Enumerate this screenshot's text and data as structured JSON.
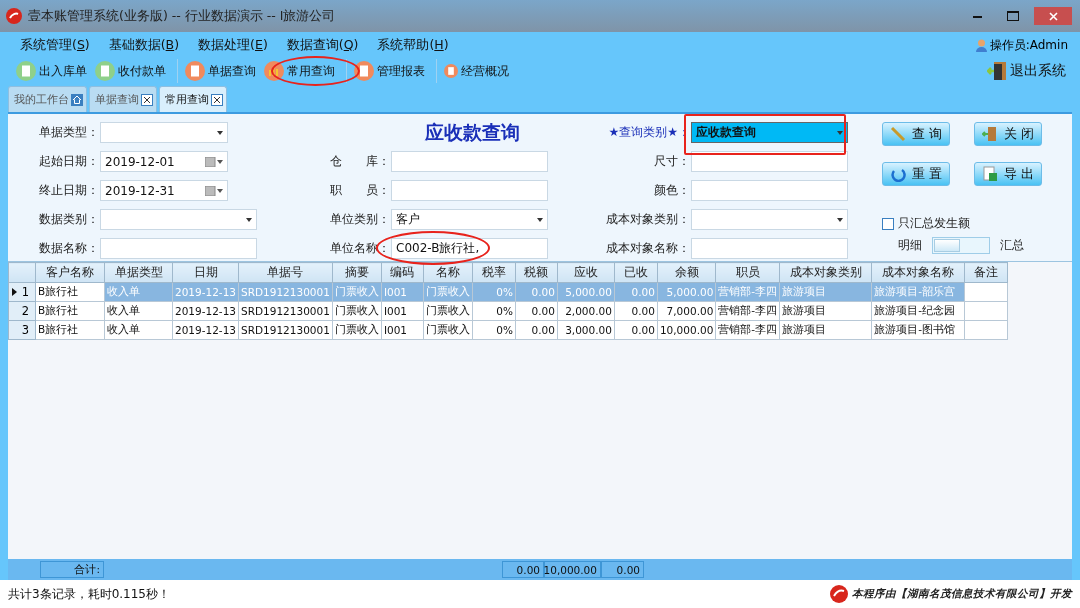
{
  "window": {
    "title": "壹本账管理系统(业务版) -- 行业数据演示 -- I旅游公司"
  },
  "menu": [
    {
      "label": "系统管理(",
      "key": "S",
      "tail": ")"
    },
    {
      "label": "基础数据(",
      "key": "B",
      "tail": ")"
    },
    {
      "label": "数据处理(",
      "key": "E",
      "tail": ")"
    },
    {
      "label": "数据查询(",
      "key": "Q",
      "tail": ")"
    },
    {
      "label": "系统帮助(",
      "key": "H",
      "tail": ")"
    }
  ],
  "operator": "操作员:Admin",
  "toolbar": [
    {
      "label": "出入库单",
      "kind": "stock",
      "separator_before": false
    },
    {
      "label": "收付款单",
      "kind": "payment",
      "separator_before": false
    },
    {
      "label": "单据查询",
      "kind": "document",
      "separator_before": true
    },
    {
      "label": "常用查询",
      "kind": "chart",
      "separator_before": false
    },
    {
      "label": "管理报表",
      "kind": "report",
      "separator_before": true
    },
    {
      "label": "经营概况",
      "kind": "overview",
      "separator_before": true
    }
  ],
  "exit": "退出系统",
  "tabs": [
    {
      "label": "我的工作台",
      "kind": "home",
      "selected": false
    },
    {
      "label": "单据查询",
      "kind": "closable",
      "selected": false
    },
    {
      "label": "常用查询",
      "kind": "closable",
      "selected": true
    }
  ],
  "form": {
    "title": "应收款查询",
    "columns": [
      [
        {
          "label": "单据类型：",
          "kind": "select"
        },
        {
          "label": "起始日期：",
          "kind": "date",
          "value": "2019-12-01"
        },
        {
          "label": "终止日期：",
          "kind": "date",
          "value": "2019-12-31"
        },
        {
          "label": "数据类别：",
          "kind": "select"
        },
        {
          "label": "数据名称：",
          "kind": "text"
        }
      ],
      [
        {
          "label": "仓　　库：",
          "kind": "text"
        },
        {
          "label": "职　　员：",
          "kind": "text"
        },
        {
          "label": "单位类别：",
          "kind": "select",
          "value": "客户"
        },
        {
          "label": "单位名称：",
          "kind": "text",
          "value": "C002-B旅行社,"
        }
      ],
      [
        {
          "label": "★查询类别★：",
          "kind": "select",
          "value": "应收款查询",
          "highlighted": true
        },
        {
          "label": "尺寸：",
          "kind": "text"
        },
        {
          "label": "颜色：",
          "kind": "text"
        },
        {
          "label": "成本对象类别：",
          "kind": "select"
        },
        {
          "label": "成本对象名称：",
          "kind": "text"
        }
      ]
    ],
    "buttons": [
      {
        "label": "查 询",
        "kind": "pencil"
      },
      {
        "label": "关 闭",
        "kind": "door"
      },
      {
        "label": "重 置",
        "kind": "reset"
      },
      {
        "label": "导 出",
        "kind": "excel"
      }
    ],
    "only_summary": {
      "label": "只汇总发生额",
      "checked": false
    },
    "mode_toggle": {
      "left": "明细",
      "right": "汇总",
      "on": false
    }
  },
  "table": {
    "columns": [
      "客户名称",
      "单据类型",
      "日期",
      "单据号",
      "摘要",
      "编码",
      "名称",
      "税率",
      "税额",
      "应收",
      "已收",
      "余额",
      "职员",
      "成本对象类别",
      "成本对象名称",
      "备注"
    ],
    "rows": [
      {
        "number": "1",
        "selected": true,
        "cells": [
          "B旅行社",
          "收入单",
          "2019-12-13",
          "SRD1912130001",
          "门票收入",
          "I001",
          "门票收入",
          "0%",
          "0.00",
          "5,000.00",
          "0.00",
          "5,000.00",
          "营销部-李四",
          "旅游项目",
          "旅游项目-韶乐宫"
        ]
      },
      {
        "number": "2",
        "selected": false,
        "cells": [
          "B旅行社",
          "收入单",
          "2019-12-13",
          "SRD1912130001",
          "门票收入",
          "I001",
          "门票收入",
          "0%",
          "0.00",
          "2,000.00",
          "0.00",
          "7,000.00",
          "营销部-李四",
          "旅游项目",
          "旅游项目-纪念园"
        ]
      },
      {
        "number": "3",
        "selected": false,
        "cells": [
          "B旅行社",
          "收入单",
          "2019-12-13",
          "SRD1912130001",
          "门票收入",
          "I001",
          "门票收入",
          "0%",
          "0.00",
          "3,000.00",
          "0.00",
          "10,000.00",
          "营销部-李四",
          "旅游项目",
          "旅游项目-图书馆"
        ]
      }
    ],
    "totals": {
      "label": "合计:",
      "tax": "0.00",
      "receivable": "10,000.00",
      "received": "0.00"
    }
  },
  "status_bar": {
    "message": "共计3条记录，耗时0.115秒！",
    "credit": "本程序由【湖南名茂信息技术有限公司】开发"
  }
}
